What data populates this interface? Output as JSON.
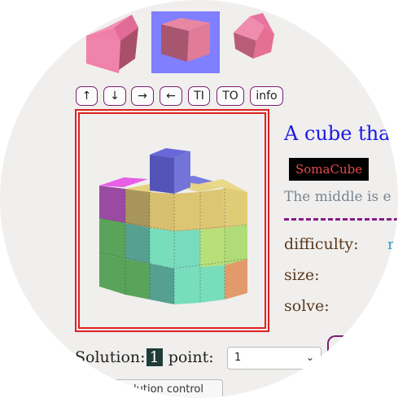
{
  "thumbnails": [
    {
      "name": "front-view",
      "color": "#f07fa8",
      "selected": false
    },
    {
      "name": "center-view",
      "color": "#d85a7a",
      "selected": true
    },
    {
      "name": "side-view",
      "color": "#e96f95",
      "selected": false
    }
  ],
  "nav_buttons": [
    "↑",
    "↓",
    "→",
    "←",
    "TI",
    "TO",
    "info"
  ],
  "puzzle": {
    "title": "A cube tha",
    "tag": "SomaCube",
    "description": "The middle is e",
    "difficulty_label": "difficulty:",
    "difficulty_value": "r",
    "size_label": "size:",
    "solve_label": "solve:"
  },
  "solution": {
    "label": "Solution:",
    "number": "1",
    "point_label": "point:",
    "point_value": "1"
  },
  "control_button": "lution control",
  "colors": {
    "accent_border": "#7a1f6e",
    "viewer_border": "#dd2222",
    "title": "#1a1ae6",
    "selected_thumb_bg": "#7f7fff"
  }
}
